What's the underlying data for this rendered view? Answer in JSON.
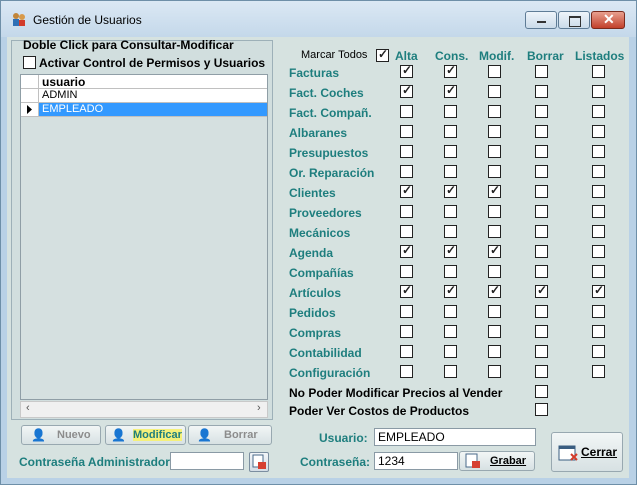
{
  "window": {
    "title": "Gestión de Usuarios"
  },
  "left": {
    "hint": "Doble Click para Consultar-Modificar",
    "activate_label": "Activar Control de Permisos y Usuarios",
    "activate_checked": false,
    "grid_header": "usuario",
    "users": [
      "ADMIN",
      "EMPLEADO"
    ],
    "selected_user": "EMPLEADO"
  },
  "buttons": {
    "nuevo": "Nuevo",
    "modificar": "Modificar",
    "borrar": "Borrar"
  },
  "admin_password_label": "Contraseña Administrador:",
  "admin_password_value": "",
  "permissions": {
    "marcar_todos_label": "Marcar Todos",
    "marcar_todos_checked": true,
    "columns": [
      "Alta",
      "Cons.",
      "Modif.",
      "Borrar",
      "Listados"
    ],
    "rows": [
      {
        "name": "Facturas",
        "values": [
          true,
          true,
          false,
          false,
          false
        ]
      },
      {
        "name": "Fact. Coches",
        "values": [
          true,
          true,
          false,
          false,
          false
        ]
      },
      {
        "name": "Fact. Compañ.",
        "values": [
          false,
          false,
          false,
          false,
          false
        ]
      },
      {
        "name": "Albaranes",
        "values": [
          false,
          false,
          false,
          false,
          false
        ]
      },
      {
        "name": "Presupuestos",
        "values": [
          false,
          false,
          false,
          false,
          false
        ]
      },
      {
        "name": "Or. Reparación",
        "values": [
          false,
          false,
          false,
          false,
          false
        ]
      },
      {
        "name": "Clientes",
        "values": [
          true,
          true,
          true,
          false,
          false
        ]
      },
      {
        "name": "Proveedores",
        "values": [
          false,
          false,
          false,
          false,
          false
        ]
      },
      {
        "name": "Mecánicos",
        "values": [
          false,
          false,
          false,
          false,
          false
        ]
      },
      {
        "name": "Agenda",
        "values": [
          true,
          true,
          true,
          false,
          false
        ]
      },
      {
        "name": "Compañías",
        "values": [
          false,
          false,
          false,
          false,
          false
        ]
      },
      {
        "name": "Artículos",
        "values": [
          true,
          true,
          true,
          true,
          true
        ]
      },
      {
        "name": "Pedidos",
        "values": [
          false,
          false,
          false,
          false,
          false
        ]
      },
      {
        "name": "Compras",
        "values": [
          false,
          false,
          false,
          false,
          false
        ]
      },
      {
        "name": "Contabilidad",
        "values": [
          false,
          false,
          false,
          false,
          false
        ]
      },
      {
        "name": "Configuración",
        "values": [
          false,
          false,
          false,
          false,
          false
        ]
      }
    ],
    "extra": [
      {
        "label": "No Poder Modificar Precios al Vender",
        "checked": false
      },
      {
        "label": "Poder Ver Costos de Productos",
        "checked": false
      }
    ]
  },
  "user_form": {
    "usuario_label": "Usuario:",
    "usuario_value": "EMPLEADO",
    "password_label": "Contraseña:",
    "password_value": "1234",
    "grabar_label": "Grabar",
    "cerrar_label": "Cerrar"
  },
  "colors": {
    "teal": "#1e7e7e",
    "selection": "#3399ff",
    "highlight": "#f5f07a"
  }
}
